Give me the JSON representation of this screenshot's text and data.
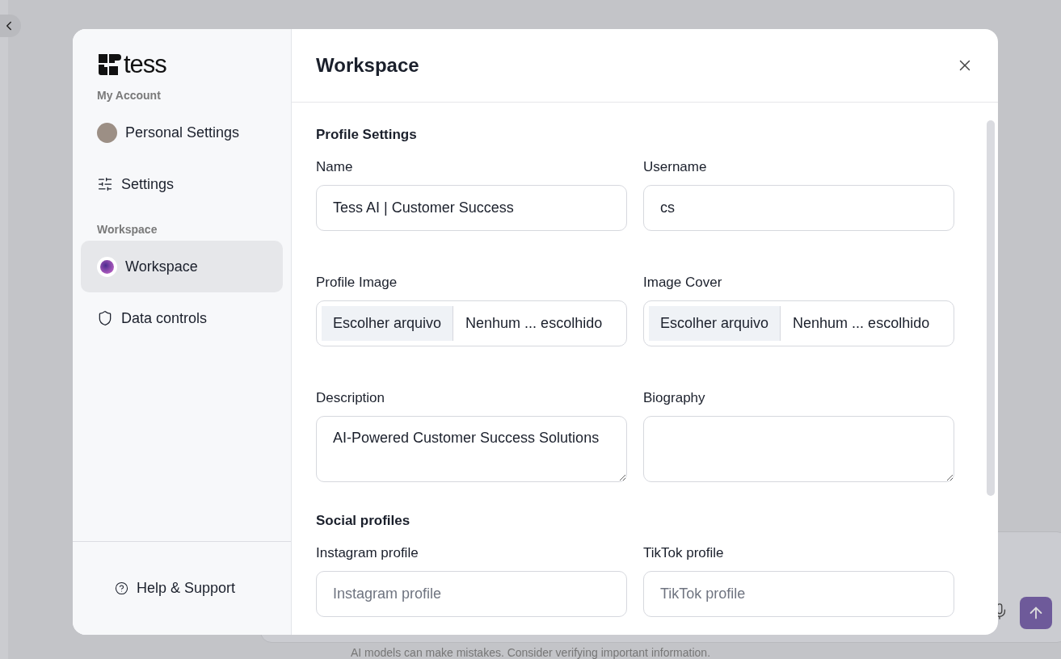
{
  "background": {
    "footer_note": "AI models can make mistakes. Consider verifying important information."
  },
  "sidebar": {
    "logo": "tess",
    "sections": [
      {
        "title": "My Account",
        "items": [
          {
            "label": "Personal Settings",
            "kind": "avatar",
            "selected": false
          },
          {
            "label": "Settings",
            "kind": "sliders",
            "selected": false
          }
        ]
      },
      {
        "title": "Workspace",
        "items": [
          {
            "label": "Workspace",
            "kind": "workspace",
            "selected": true
          },
          {
            "label": "Data controls",
            "kind": "shield",
            "selected": false
          }
        ]
      }
    ],
    "help": "Help & Support"
  },
  "main": {
    "title": "Workspace",
    "sections": [
      {
        "title": "Profile Settings",
        "fields": [
          {
            "label": "Name",
            "kind": "text",
            "value": "Tess AI | Customer Success"
          },
          {
            "label": "Username",
            "kind": "text",
            "value": "cs"
          },
          {
            "label": "Profile Image",
            "kind": "file",
            "button": "Escolher arquivo",
            "status": "Nenhum ... escolhido"
          },
          {
            "label": "Image Cover",
            "kind": "file",
            "button": "Escolher arquivo",
            "status": "Nenhum ... escolhido"
          },
          {
            "label": "Description",
            "kind": "textarea",
            "value": "AI-Powered Customer Success Solutions"
          },
          {
            "label": "Biography",
            "kind": "textarea"
          }
        ]
      },
      {
        "title": "Social profiles",
        "fields": [
          {
            "label": "Instagram profile",
            "kind": "text",
            "placeholder": "Instagram profile"
          },
          {
            "label": "TikTok profile",
            "kind": "text",
            "placeholder": "TikTok profile"
          }
        ]
      }
    ]
  }
}
